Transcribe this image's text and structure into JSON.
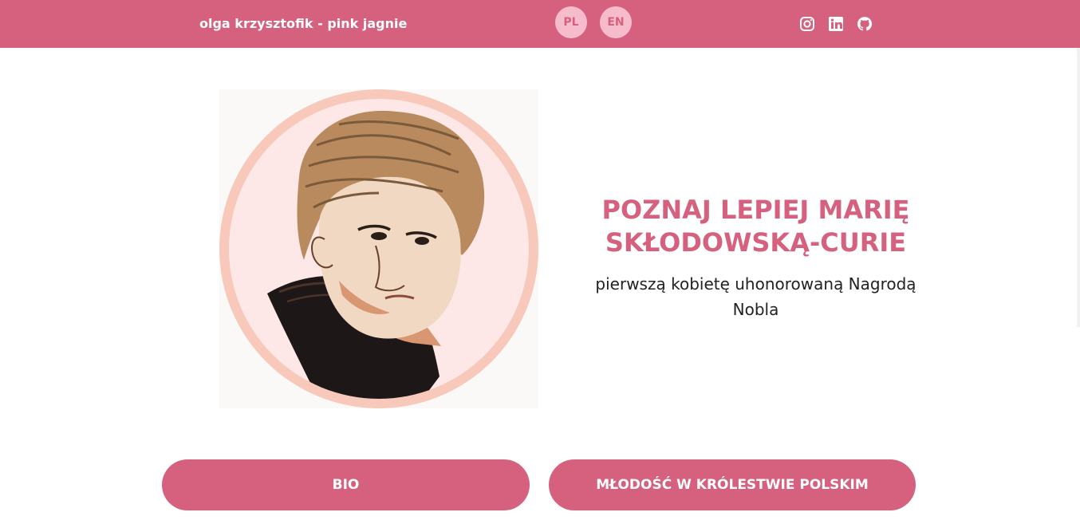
{
  "header": {
    "brand": "olga krzysztofik - pink jagnie",
    "languages": [
      {
        "label": "PL",
        "active": true
      },
      {
        "label": "EN",
        "active": false
      }
    ],
    "social": [
      "instagram-icon",
      "linkedin-icon",
      "github-icon"
    ]
  },
  "hero": {
    "title": "POZNAJ LEPIEJ MARIĘ SKŁODOWSKĄ-CURIE",
    "subtitle": "pierwszą kobietę uhonorowaną Nagrodą Nobla"
  },
  "buttons": {
    "bio": "BIO",
    "youth": "MŁODOŚĆ W KRÓLESTWIE POLSKIM"
  },
  "colors": {
    "accent": "#d5617f",
    "lang_bg": "#f7bccb",
    "ring": "#f8c9bb",
    "portrait_bg": "#fde7e7"
  }
}
